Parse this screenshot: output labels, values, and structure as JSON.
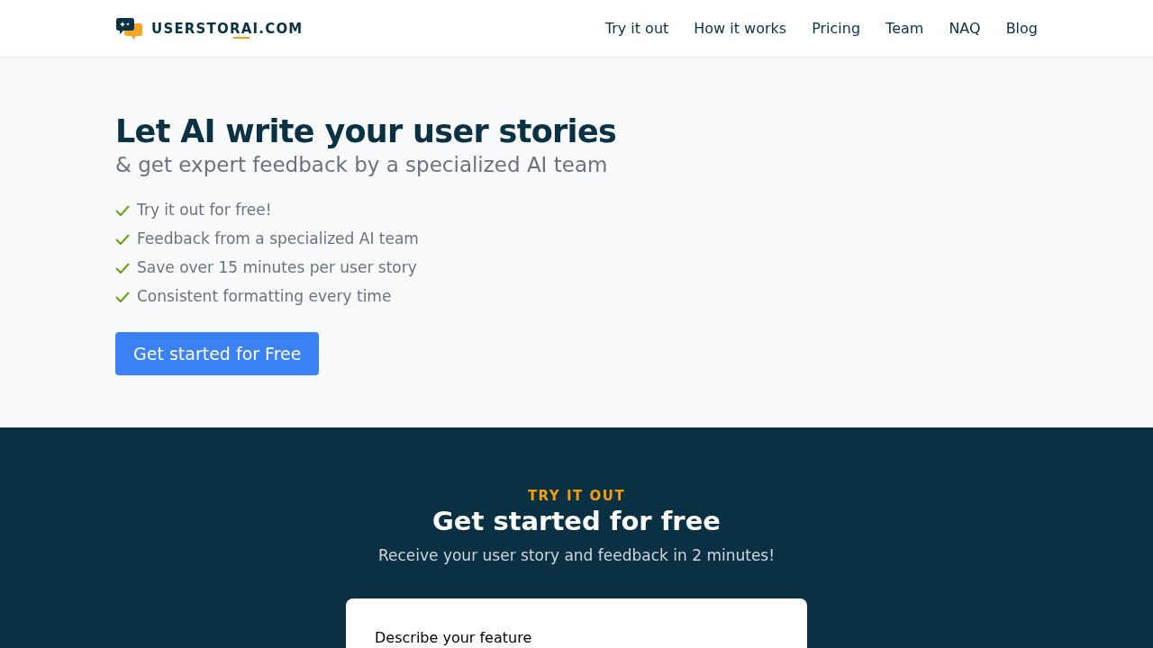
{
  "logo": {
    "text": "USERSTORAI.COM"
  },
  "nav": [
    "Try it out",
    "How it works",
    "Pricing",
    "Team",
    "NAQ",
    "Blog"
  ],
  "hero": {
    "title": "Let AI write your user stories",
    "subtitle": "& get expert feedback by a specialized AI team",
    "features": [
      "Try it out for free!",
      "Feedback from a specialized AI team",
      "Save over 15 minutes per user story",
      "Consistent formatting every time"
    ],
    "button": "Get started for Free"
  },
  "try_section": {
    "eyebrow": "TRY IT OUT",
    "title": "Get started for free",
    "description": "Receive your user story and feedback in 2 minutes!",
    "form": {
      "label": "Describe your feature"
    }
  }
}
